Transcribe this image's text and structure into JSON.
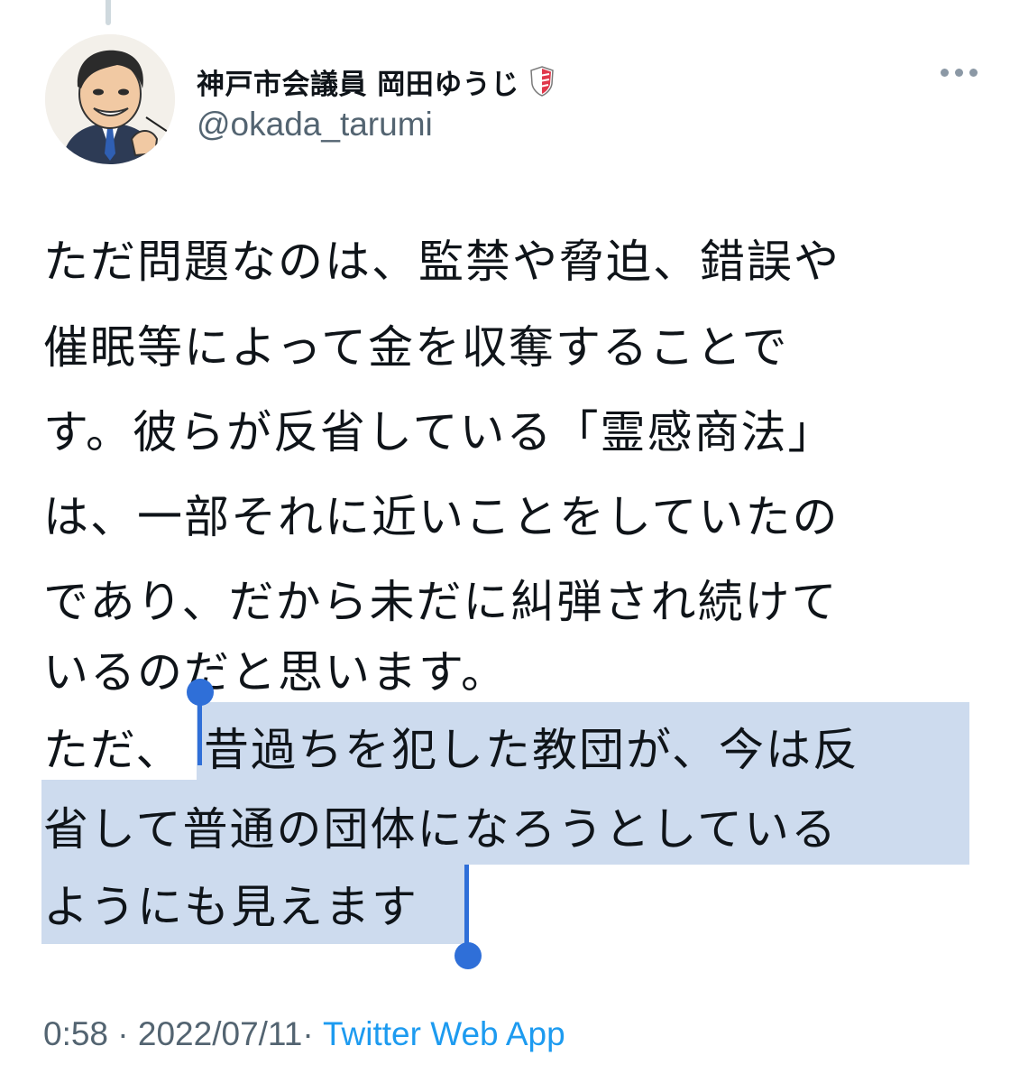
{
  "author": {
    "display_name": "神戸市会議員 岡田ゆうじ",
    "handle": "@okada_tarumi",
    "avatar_icon": "caricature-portrait-avatar",
    "badge_icon": "red-white-shield-badge-icon"
  },
  "menu_icon": "more-options-icon",
  "tweet": {
    "lines": [
      "ただ問題なのは、監禁や脅迫、錯誤や",
      "催眠等によって金を収奪することで",
      "す。彼らが反省している「霊感商法」",
      "は、一部それに近いことをしていたの",
      "であり、だから未だに糾弾され続けて",
      "いるのだと思います。",
      "ただ、",
      "昔過ちを犯した教団が、今は反",
      "省して普通の団体になろうとしている",
      "ようにも見えます"
    ]
  },
  "meta": {
    "time": "0:58",
    "sep1": " · ",
    "date": "2022/07/11",
    "sep2": "· ",
    "source": "Twitter Web App"
  },
  "colors": {
    "text": "#0f1419",
    "secondary": "#536471",
    "link": "#1d9bf0",
    "selection": "#cddbee",
    "selection_handle": "#2f6fd8"
  }
}
